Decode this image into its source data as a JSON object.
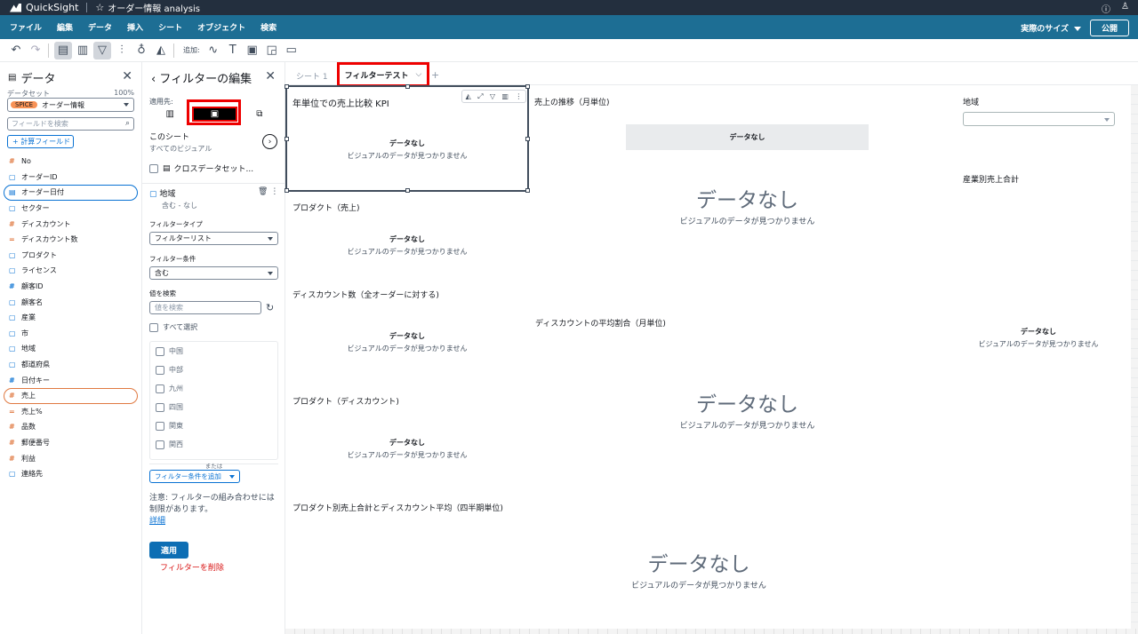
{
  "topbar": {
    "app": "QuickSight",
    "analysis": "オーダー情報 analysis",
    "help": "?",
    "user": "ユーザー"
  },
  "menu": {
    "items": [
      "ファイル",
      "編集",
      "データ",
      "挿入",
      "シート",
      "オブジェクト",
      "検索"
    ],
    "size": "実際のサイズ",
    "publish": "公開"
  },
  "toolbar": {
    "add_label": "追加:"
  },
  "data_panel": {
    "title": "データ",
    "dataset_label": "データセット",
    "dataset_pct": "100%",
    "spice": "SPICE",
    "dataset_name": "オーダー情報",
    "search_placeholder": "フィールドを検索",
    "calc_field": "+ 計算フィールド",
    "fields": [
      {
        "icon": "#",
        "type": "meas",
        "name": "No"
      },
      {
        "icon": "▢",
        "type": "dim",
        "name": "オーダーID"
      },
      {
        "icon": "▤",
        "type": "dim",
        "name": "オーダー日付",
        "hl": "blue"
      },
      {
        "icon": "▢",
        "type": "dim",
        "name": "セクター"
      },
      {
        "icon": "#",
        "type": "meas",
        "name": "ディスカウント"
      },
      {
        "icon": "=",
        "type": "meas",
        "name": "ディスカウント数"
      },
      {
        "icon": "▢",
        "type": "dim",
        "name": "プロダクト"
      },
      {
        "icon": "▢",
        "type": "dim",
        "name": "ライセンス"
      },
      {
        "icon": "#",
        "type": "dim",
        "name": "顧客ID"
      },
      {
        "icon": "▢",
        "type": "dim",
        "name": "顧客名"
      },
      {
        "icon": "▢",
        "type": "dim",
        "name": "産業"
      },
      {
        "icon": "▢",
        "type": "dim",
        "name": "市"
      },
      {
        "icon": "▢",
        "type": "dim",
        "name": "地域"
      },
      {
        "icon": "▢",
        "type": "dim",
        "name": "都道府県"
      },
      {
        "icon": "#",
        "type": "dim",
        "name": "日付キー"
      },
      {
        "icon": "#",
        "type": "meas",
        "name": "売上",
        "hl": "orange"
      },
      {
        "icon": "=",
        "type": "meas",
        "name": "売上%"
      },
      {
        "icon": "#",
        "type": "meas",
        "name": "品数"
      },
      {
        "icon": "#",
        "type": "meas",
        "name": "郵便番号"
      },
      {
        "icon": "#",
        "type": "meas",
        "name": "利益"
      },
      {
        "icon": "▢",
        "type": "dim",
        "name": "連絡先"
      }
    ]
  },
  "filter_panel": {
    "title": "フィルターの編集",
    "applies_to": "適用先:",
    "this_sheet": "このシート",
    "all_visuals": "すべてのビジュアル",
    "cross_dataset": "クロスデータセット...",
    "field": "地域",
    "field_sub": "含む - なし",
    "type_label": "フィルタータイプ",
    "type_value": "フィルターリスト",
    "cond_label": "フィルター条件",
    "cond_value": "含む",
    "value_search_label": "値を検索",
    "value_search_placeholder": "値を検索",
    "select_all": "すべて選択",
    "values": [
      "中国",
      "中部",
      "九州",
      "四国",
      "関東",
      "関西"
    ],
    "or": "または",
    "add_condition": "フィルター条件を追加",
    "note": "注意: フィルターの組み合わせには制限があります。",
    "details": "詳細",
    "apply": "適用",
    "delete": "フィルターを削除"
  },
  "tabs": {
    "sheet1": "シート 1",
    "active": "フィルターテスト",
    "plus": "+"
  },
  "visuals": {
    "kpi_title": "年単位での売上比較 KPI",
    "trend_title": "売上の推移（月単位)",
    "region_title": "地域",
    "industry_title": "産業別売上合計",
    "product_sales": "プロダクト（売上)",
    "discount_count": "ディスカウント数（全オーダーに対する)",
    "discount_avg": "ディスカウントの平均割合（月単位)",
    "product_discount": "プロダクト（ディスカウント)",
    "product_combo": "プロダクト別売上合計とディスカウント平均（四半期単位)"
  },
  "nodata": {
    "title": "データなし",
    "sub": "ビジュアルのデータが見つかりません"
  }
}
